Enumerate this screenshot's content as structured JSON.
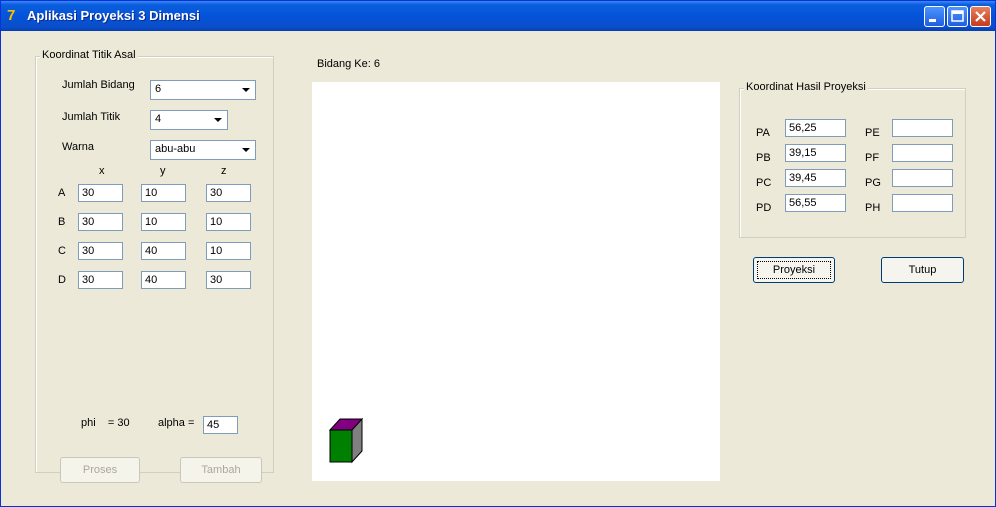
{
  "window": {
    "title": "Aplikasi Proyeksi 3 Dimensi",
    "icon": "app-icon-7"
  },
  "origin_group": {
    "legend": "Koordinat Titik Asal",
    "jumlah_bidang_label": "Jumlah Bidang",
    "jumlah_bidang_value": "6",
    "jumlah_titik_label": "Jumlah Titik",
    "jumlah_titik_value": "4",
    "warna_label": "Warna",
    "warna_value": "abu-abu",
    "col_x": "x",
    "col_y": "y",
    "col_z": "z",
    "points": [
      {
        "label": "A",
        "x": "30",
        "y": "10",
        "z": "30"
      },
      {
        "label": "B",
        "x": "30",
        "y": "10",
        "z": "10"
      },
      {
        "label": "C",
        "x": "30",
        "y": "40",
        "z": "10"
      },
      {
        "label": "D",
        "x": "30",
        "y": "40",
        "z": "30"
      }
    ],
    "phi_text": "phi    = 30",
    "alpha_label": "alpha =",
    "alpha_value": "45"
  },
  "buttons": {
    "proses": "Proses",
    "tambah": "Tambah",
    "proyeksi": "Proyeksi",
    "tutup": "Tutup"
  },
  "canvas": {
    "bidang_label": "Bidang Ke: 6"
  },
  "result_group": {
    "legend": "Koordinat Hasil Proyeksi",
    "left": [
      {
        "label": "PA",
        "value": "56,25"
      },
      {
        "label": "PB",
        "value": "39,15"
      },
      {
        "label": "PC",
        "value": "39,45"
      },
      {
        "label": "PD",
        "value": "56,55"
      }
    ],
    "right": [
      {
        "label": "PE",
        "value": ""
      },
      {
        "label": "PF",
        "value": ""
      },
      {
        "label": "PG",
        "value": ""
      },
      {
        "label": "PH",
        "value": ""
      }
    ]
  },
  "colors": {
    "cube_front": "#008000",
    "cube_top": "#800080",
    "cube_side": "#808080"
  }
}
